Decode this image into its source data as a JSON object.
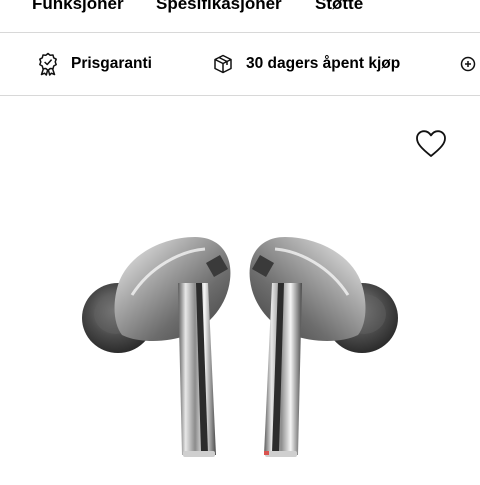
{
  "nav": {
    "tabs": [
      {
        "label": "Funksjoner"
      },
      {
        "label": "Spesifikasjoner"
      },
      {
        "label": "Støtte"
      }
    ]
  },
  "benefits": [
    {
      "label": "Prisgaranti",
      "icon": "award-badge-icon"
    },
    {
      "label": "30 dagers åpent kjøp",
      "icon": "package-return-icon"
    },
    {
      "label": "",
      "icon": "plus-circle-icon"
    }
  ],
  "product": {
    "image": "earbuds-image",
    "wishlist_icon": "heart-icon"
  }
}
